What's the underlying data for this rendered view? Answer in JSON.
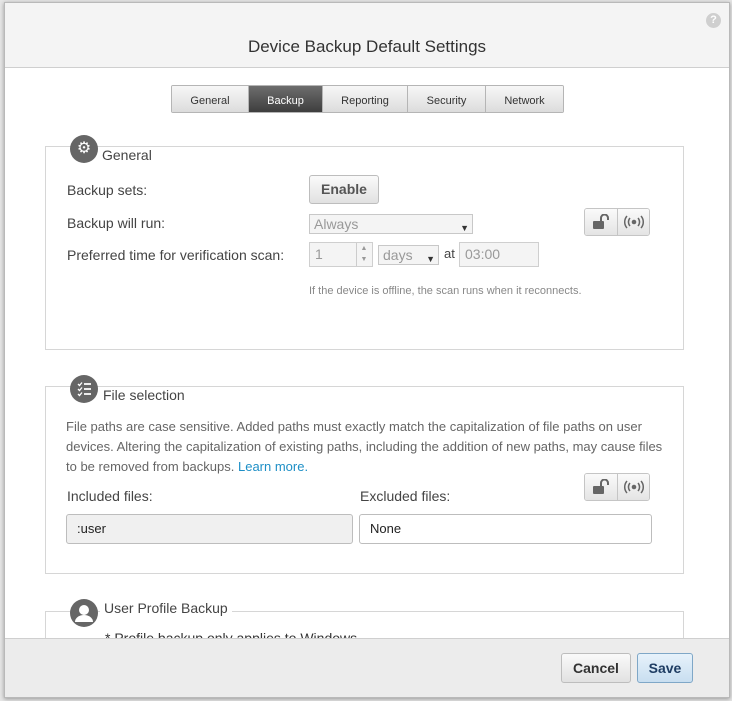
{
  "dialog": {
    "title": "Device Backup Default Settings",
    "help_symbol": "?"
  },
  "tabs": [
    {
      "label": "General",
      "active": false
    },
    {
      "label": "Backup",
      "active": true
    },
    {
      "label": "Reporting",
      "active": false
    },
    {
      "label": "Security",
      "active": false
    },
    {
      "label": "Network",
      "active": false
    }
  ],
  "general": {
    "title": "General",
    "icon": "gear-icon",
    "backup_sets_label": "Backup sets:",
    "enable_button": "Enable",
    "backup_run_label": "Backup will run:",
    "backup_run_value": "Always",
    "verification_label": "Preferred time for verification scan:",
    "verification_number": "1",
    "verification_unit": "days",
    "at_label": "at",
    "verification_time": "03:00",
    "offline_hint": "If the device is offline, the scan runs when it reconnects."
  },
  "file_selection": {
    "title": "File selection",
    "icon": "checklist-icon",
    "description": "File paths are case sensitive. Added paths must exactly match the capitalization of file paths on user devices. Altering the capitalization of existing paths, including the addition of new paths, may cause files to be removed from backups.",
    "learn_more": "Learn more.",
    "included_label": "Included files:",
    "included_value": ":user",
    "excluded_label": "Excluded files:",
    "excluded_value": "None"
  },
  "user_profile": {
    "title": "User Profile Backup",
    "icon": "user-icon",
    "note": "* Profile backup only applies to Windows"
  },
  "footer": {
    "cancel": "Cancel",
    "save": "Save"
  },
  "colors": {
    "accent": "#1e8fc6",
    "active_tab": "#4a4a4a",
    "save_button": "#d6e8f6"
  }
}
